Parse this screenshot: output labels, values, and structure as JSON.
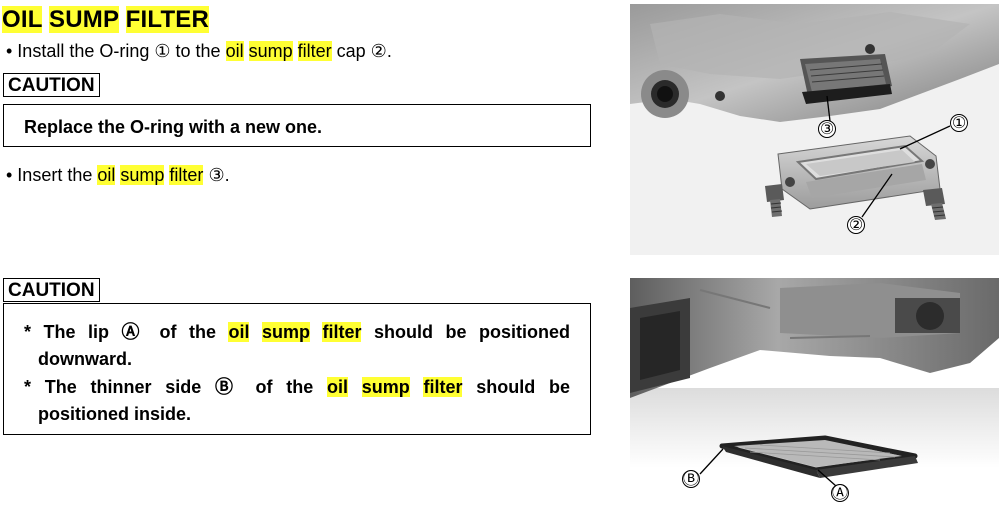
{
  "title": {
    "w1": "OIL",
    "w2": "SUMP",
    "w3": "FILTER"
  },
  "step1": {
    "pre": "• Install the O-ring ① to the",
    "w1": "oil",
    "w2": "sump",
    "w3": "filter",
    "post": "cap ②."
  },
  "caution1": {
    "label": "CAUTION",
    "text": "Replace the O-ring with a new one."
  },
  "step2": {
    "pre": "• Insert the",
    "w1": "oil",
    "w2": "sump",
    "w3": "filter",
    "post": "③."
  },
  "caution2": {
    "label": "CAUTION",
    "note1": {
      "pre": "* The lip Ⓐ of the",
      "w1": "oil",
      "w2": "sump",
      "w3": "filter",
      "post": "should be positioned",
      "cont": "downward."
    },
    "note2": {
      "pre": "* The thinner side Ⓑ of the",
      "w1": "oil",
      "w2": "sump",
      "w3": "filter",
      "post": "should be",
      "cont": "positioned inside."
    }
  },
  "photo1": {
    "callout_1": "①",
    "callout_2": "②",
    "callout_3": "③"
  },
  "photo2": {
    "callout_a": "Ⓐ",
    "callout_b": "Ⓑ"
  },
  "colors": {
    "highlight": "#ffff33"
  }
}
